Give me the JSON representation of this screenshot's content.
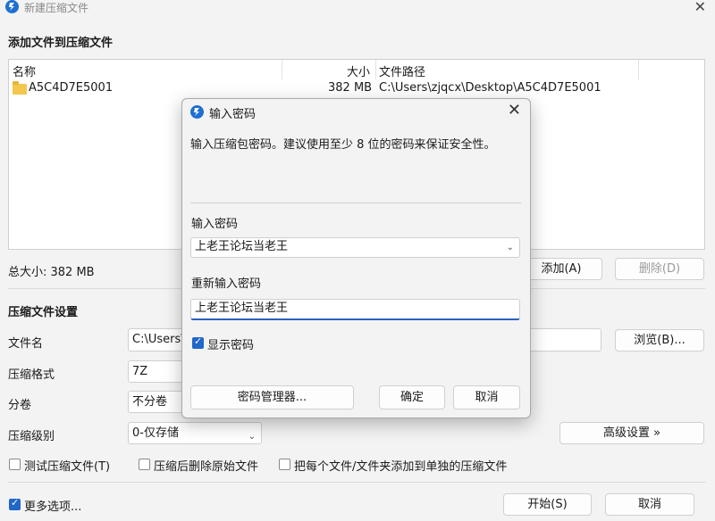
{
  "window": {
    "title": "新建压缩文件",
    "close_glyph": "✕"
  },
  "add_section": {
    "title": "添加文件到压缩文件",
    "columns": {
      "name": "名称",
      "size": "大小",
      "path": "文件路径"
    },
    "rows": [
      {
        "name": "A5C4D7E5001",
        "size": "382 MB",
        "path": "C:\\Users\\zjqcx\\Desktop\\A5C4D7E5001"
      }
    ],
    "total_size": "总大小: 382 MB",
    "add_button": "添加(A)",
    "delete_button": "删除(D)"
  },
  "settings": {
    "title": "压缩文件设置",
    "filename_label": "文件名",
    "filename_value": "C:\\Users\\",
    "browse_button": "浏览(B)...",
    "format_label": "压缩格式",
    "format_value": "7Z",
    "volume_label": "分卷",
    "volume_value": "不分卷",
    "level_label": "压缩级别",
    "level_value": "0-仅存储",
    "advanced_button": "高级设置 »",
    "test_checkbox": "测试压缩文件(T)",
    "delete_after_checkbox": "压缩后删除原始文件",
    "separate_checkbox": "把每个文件/文件夹添加到单独的压缩文件"
  },
  "footer": {
    "more_options": "更多选项...",
    "start_button": "开始(S)",
    "cancel_button": "取消"
  },
  "dialog": {
    "title": "输入密码",
    "close_glyph": "✕",
    "description": "输入压缩包密码。建议使用至少 8 位的密码来保证安全性。",
    "password_label": "输入密码",
    "password_value": "上老王论坛当老王",
    "reenter_label": "重新输入密码",
    "reenter_value": "上老王论坛当老王",
    "show_password": "显示密码",
    "manager_button": "密码管理器...",
    "ok_button": "确定",
    "cancel_button": "取消"
  },
  "colors": {
    "accent": "#2067c9",
    "folder": "#f3c74b"
  }
}
